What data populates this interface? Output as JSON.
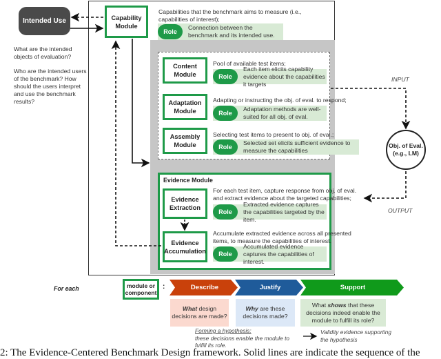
{
  "intended_use": {
    "label": "Intended Use",
    "questions": [
      "What are the intended objects of evaluation?",
      "Who are the intended users of the benchmark? How should the users interpret and use the benchmark results?"
    ]
  },
  "capability": {
    "module": "Capability Module",
    "description": "Capabilities that the benchmark aims to measure (i.e., capabilities of interest);",
    "role": "Connection between the benchmark and its intended use."
  },
  "role_label": "Role",
  "content": {
    "module": "Content Module",
    "description": "Pool of available test items;",
    "role": "Each item elicits capability evidence about the capabilities it targets"
  },
  "adaptation": {
    "module": "Adaptation Module",
    "description": "Adapting or instructing the obj. of eval. to respond;",
    "role": "Adaptation methods are well-suited for all obj. of eval."
  },
  "assembly": {
    "module": "Assembly Module",
    "description": "Selecting test items to present to obj. of eval.;",
    "role": "Selected set elicits sufficient evidence to measure the capabilities"
  },
  "evidence": {
    "title": "Evidence Module",
    "extraction": {
      "module": "Evidence Extraction",
      "description": "For each test item, capture response from obj. of eval. and extract evidence about the targeted capabilities;",
      "role": "Extracted evidence captures the capabilities targeted by the item."
    },
    "accumulation": {
      "module": "Evidence Accumulation",
      "description": "Accumulate extracted evidence across all presented items, to measure the capabilities of interest.",
      "role": "Accumulated evidence captures the capabilities of interest."
    }
  },
  "obj_eval": {
    "line1": "Obj. of Eval.",
    "line2": "(e.g., LM)"
  },
  "io": {
    "input": "INPUT",
    "output": "OUTPUT"
  },
  "bottom": {
    "for_each": "For each",
    "module_or_component": "module or component",
    "colon": ":",
    "steps": [
      {
        "label": "Describe",
        "color": "#c9410b",
        "bg": "#fbd9cf",
        "q_bold": "What",
        "q_rest": " design decisions are made?"
      },
      {
        "label": "Justify",
        "color": "#1f5b9a",
        "bg": "#dce8f7",
        "q_bold": "Why",
        "q_rest": " are these decisions made?"
      },
      {
        "label": "Support",
        "color": "#109a1b",
        "bg": "#d9ead5",
        "q_pre": "What ",
        "q_bold": "shows",
        "q_rest": " that these decisions indeed enable the module to fulfill its role?"
      }
    ],
    "hypothesis_title": "Forming a hypothesis:",
    "hypothesis_body": "these decisions enable the module to fulfill its role.",
    "validity": "Validity evidence supporting the hypothesis"
  },
  "caption": "2: The Evidence-Centered Benchmark Design framework. Solid lines are indicate the sequence of the"
}
